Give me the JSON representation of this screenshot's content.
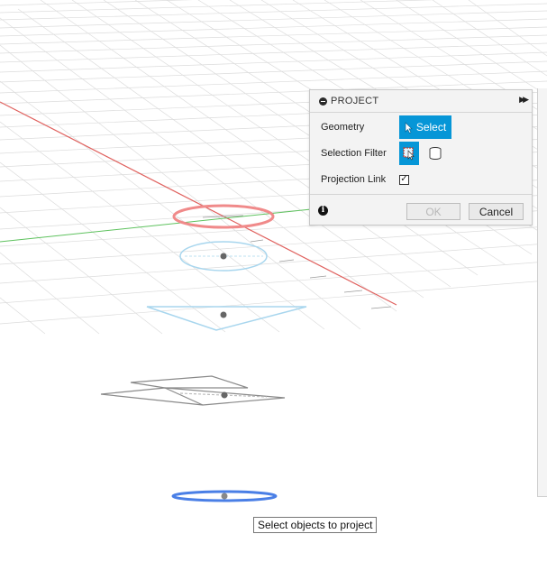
{
  "dialog": {
    "title": "PROJECT",
    "geometry_label": "Geometry",
    "select_label": "Select",
    "selection_filter_label": "Selection Filter",
    "projection_link_label": "Projection Link",
    "projection_link_checked": true,
    "ok_label": "OK",
    "cancel_label": "Cancel"
  },
  "tooltip": {
    "text": "Select objects to project"
  },
  "colors": {
    "accent": "#0696d7",
    "x_axis": "#e0625f",
    "y_axis": "#5ec25e",
    "grid": "#d8d8d8",
    "selection_highlight": "#4a7fe6",
    "preview_blue": "#a8d6ee"
  },
  "icons": {
    "collapse": "minus-circle-icon",
    "expand": "double-chevron-right-icon",
    "select_cursor": "cursor-arrow-icon",
    "filter_sketch": "sketch-filter-icon",
    "filter_body": "body-cylinder-icon",
    "info": "info-icon"
  }
}
